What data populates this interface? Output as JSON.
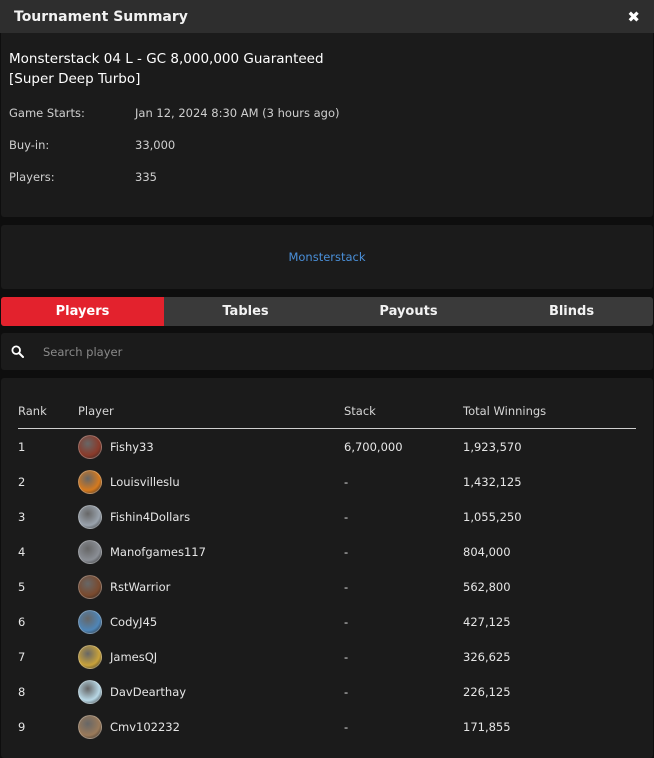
{
  "header": {
    "title": "Tournament Summary",
    "close_icon": "close-icon"
  },
  "tournament": {
    "name": "Monsterstack 04 L - GC 8,000,000 Guaranteed [Super Deep Turbo]",
    "game_starts_label": "Game Starts:",
    "game_starts_value": "Jan 12, 2024 8:30 AM (3 hours ago)",
    "buyin_label": "Buy-in:",
    "buyin_value": "33,000",
    "players_label": "Players:",
    "players_value": "335"
  },
  "series_link": "Monsterstack",
  "tabs": [
    {
      "label": "Players",
      "active": true
    },
    {
      "label": "Tables",
      "active": false
    },
    {
      "label": "Payouts",
      "active": false
    },
    {
      "label": "Blinds",
      "active": false
    }
  ],
  "search": {
    "placeholder": "Search player",
    "value": ""
  },
  "table": {
    "headers": {
      "rank": "Rank",
      "player": "Player",
      "stack": "Stack",
      "winnings": "Total Winnings"
    },
    "rows": [
      {
        "rank": "1",
        "player": "Fishy33",
        "stack": "6,700,000",
        "winnings": "1,923,570",
        "avatar_color": "#8a3a2a"
      },
      {
        "rank": "2",
        "player": "Louisvilleslu",
        "stack": "-",
        "winnings": "1,432,125",
        "avatar_color": "#d67a1e"
      },
      {
        "rank": "3",
        "player": "Fishin4Dollars",
        "stack": "-",
        "winnings": "1,055,250",
        "avatar_color": "#9aa3ad"
      },
      {
        "rank": "4",
        "player": "Manofgames117",
        "stack": "-",
        "winnings": "804,000",
        "avatar_color": "#8b8f96"
      },
      {
        "rank": "5",
        "player": "RstWarrior",
        "stack": "-",
        "winnings": "562,800",
        "avatar_color": "#7a4a2e"
      },
      {
        "rank": "6",
        "player": "CodyJ45",
        "stack": "-",
        "winnings": "427,125",
        "avatar_color": "#4f86b8"
      },
      {
        "rank": "7",
        "player": "JamesQJ",
        "stack": "-",
        "winnings": "326,625",
        "avatar_color": "#c9a23a"
      },
      {
        "rank": "8",
        "player": "DavDearthay",
        "stack": "-",
        "winnings": "226,125",
        "avatar_color": "#b8d8e6"
      },
      {
        "rank": "9",
        "player": "Cmv102232",
        "stack": "-",
        "winnings": "171,855",
        "avatar_color": "#9a7a5a"
      }
    ]
  }
}
